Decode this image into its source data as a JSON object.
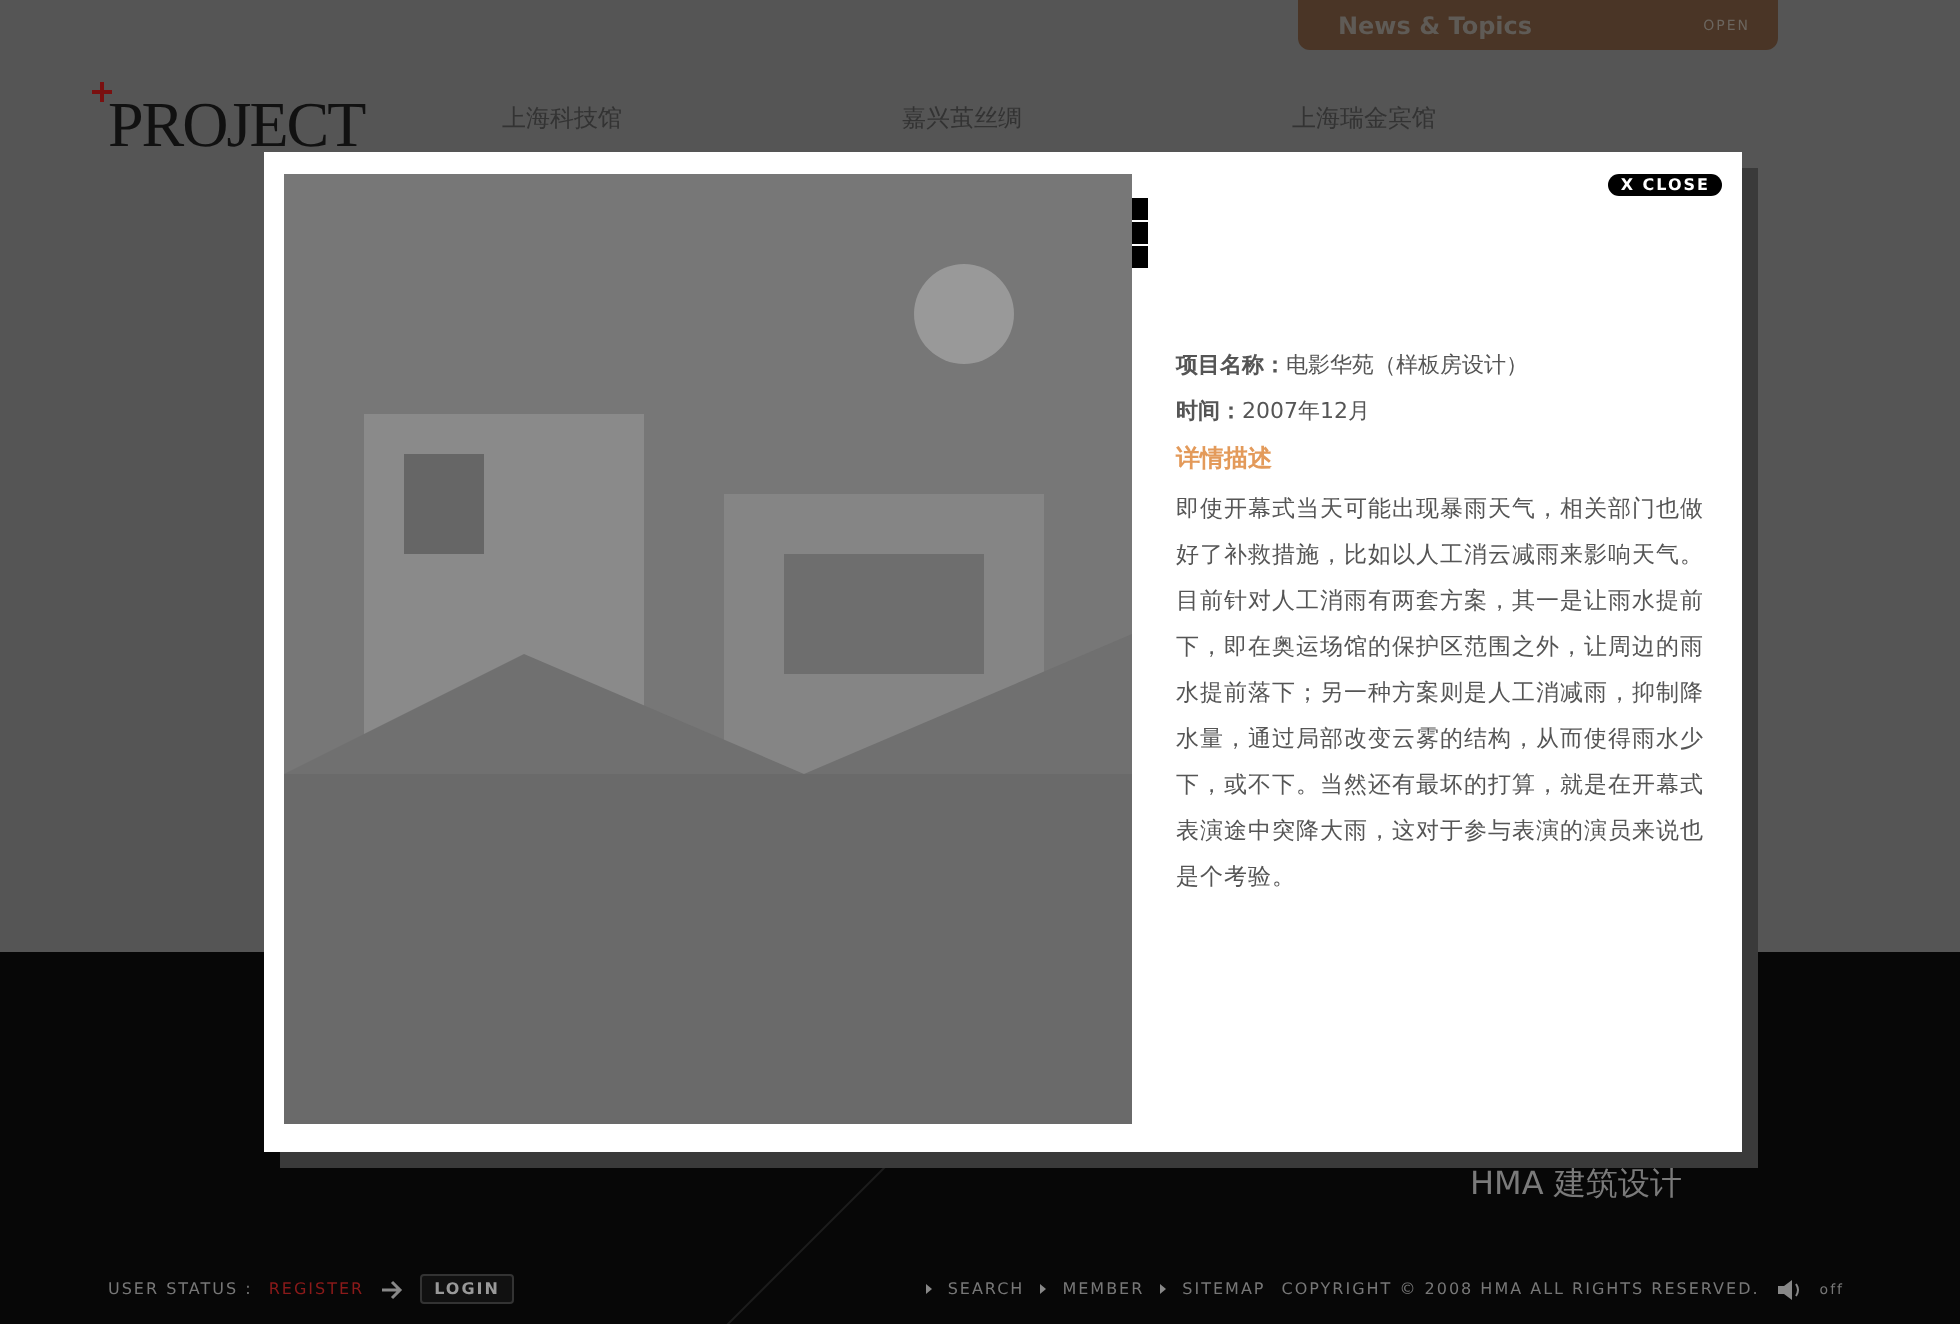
{
  "news_tab": {
    "title": "News & Topics",
    "action": "OPEN"
  },
  "logo": {
    "text": "PROJECT"
  },
  "nav": [
    "上海科技馆",
    "嘉兴茧丝绸",
    "上海瑞金宾馆"
  ],
  "tagline": "HMA 建筑设计",
  "modal": {
    "close": "X CLOSE",
    "fields": [
      {
        "label": "项目名称：",
        "value": "电影华苑（样板房设计）"
      },
      {
        "label": "时间：",
        "value": "2007年12月"
      }
    ],
    "section_title": "详情描述",
    "description": "即使开幕式当天可能出现暴雨天气，相关部门也做好了补救措施，比如以人工消云减雨来影响天气。目前针对人工消雨有两套方案，其一是让雨水提前下，即在奥运场馆的保护区范围之外，让周边的雨水提前落下；另一种方案则是人工消减雨，抑制降水量，通过局部改变云雾的结构，从而使得雨水少下，或不下。当然还有最坏的打算，就是在开幕式表演途中突降大雨，这对于参与表演的演员来说也是个考验。"
  },
  "footer": {
    "user_status": "USER STATUS :",
    "register": "REGISTER",
    "login": "LOGIN",
    "links": [
      "SEARCH",
      "MEMBER",
      "SITEMAP"
    ],
    "copyright": "COPYRIGHT © 2008 HMA ALL RIGHTS RESERVED.",
    "sound": "off"
  }
}
